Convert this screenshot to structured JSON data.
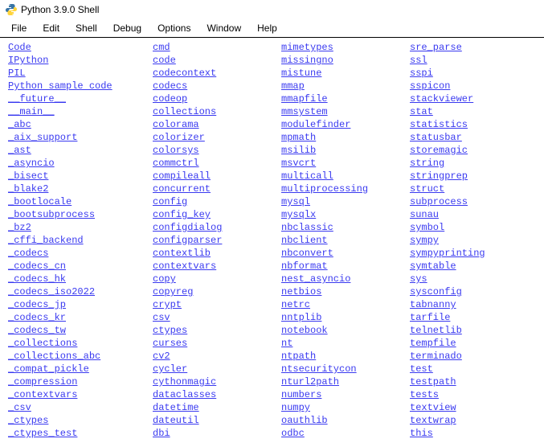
{
  "window": {
    "title": "Python 3.9.0 Shell"
  },
  "menu": {
    "items": [
      "File",
      "Edit",
      "Shell",
      "Debug",
      "Options",
      "Window",
      "Help"
    ]
  },
  "modules": {
    "col0": [
      "Code",
      "IPython",
      "PIL",
      "Python sample code",
      "__future__",
      "__main__",
      "_abc",
      "_aix_support",
      "_ast",
      "_asyncio",
      "_bisect",
      "_blake2",
      "_bootlocale",
      "_bootsubprocess",
      "_bz2",
      "_cffi_backend",
      "_codecs",
      "_codecs_cn",
      "_codecs_hk",
      "_codecs_iso2022",
      "_codecs_jp",
      "_codecs_kr",
      "_codecs_tw",
      "_collections",
      "_collections_abc",
      "_compat_pickle",
      "_compression",
      "_contextvars",
      "_csv",
      "_ctypes",
      "_ctypes_test"
    ],
    "col1": [
      "cmd",
      "code",
      "codecontext",
      "codecs",
      "codeop",
      "collections",
      "colorama",
      "colorizer",
      "colorsys",
      "commctrl",
      "compileall",
      "concurrent",
      "config",
      "config_key",
      "configdialog",
      "configparser",
      "contextlib",
      "contextvars",
      "copy",
      "copyreg",
      "crypt",
      "csv",
      "ctypes",
      "curses",
      "cv2",
      "cycler",
      "cythonmagic",
      "dataclasses",
      "datetime",
      "dateutil",
      "dbi"
    ],
    "col2": [
      "mimetypes",
      "missingno",
      "mistune",
      "mmap",
      "mmapfile",
      "mmsystem",
      "modulefinder",
      "mpmath",
      "msilib",
      "msvcrt",
      "multicall",
      "multiprocessing",
      "mysql",
      "mysqlx",
      "nbclassic",
      "nbclient",
      "nbconvert",
      "nbformat",
      "nest_asyncio",
      "netbios",
      "netrc",
      "nntplib",
      "notebook",
      "nt",
      "ntpath",
      "ntsecuritycon",
      "nturl2path",
      "numbers",
      "numpy",
      "oauthlib",
      "odbc"
    ],
    "col3": [
      "sre_parse",
      "ssl",
      "sspi",
      "sspicon",
      "stackviewer",
      "stat",
      "statistics",
      "statusbar",
      "storemagic",
      "string",
      "stringprep",
      "struct",
      "subprocess",
      "sunau",
      "symbol",
      "sympy",
      "sympyprinting",
      "symtable",
      "sys",
      "sysconfig",
      "tabnanny",
      "tarfile",
      "telnetlib",
      "tempfile",
      "terminado",
      "test",
      "testpath",
      "tests",
      "textview",
      "textwrap",
      "this"
    ]
  }
}
